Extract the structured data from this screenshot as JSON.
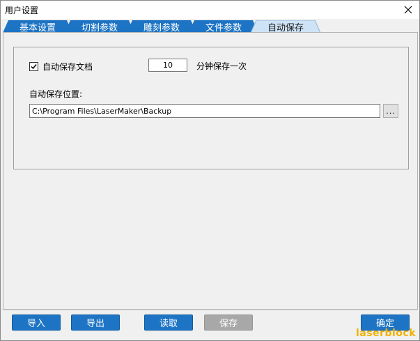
{
  "window": {
    "title": "用户设置"
  },
  "tabs": [
    {
      "label": "基本设置",
      "active": false
    },
    {
      "label": "切割参数",
      "active": false
    },
    {
      "label": "雕刻参数",
      "active": false
    },
    {
      "label": "文件参数",
      "active": false
    },
    {
      "label": "自动保存",
      "active": true
    }
  ],
  "autosave": {
    "enable_label": "自动保存文档",
    "enabled": true,
    "interval_value": "10",
    "interval_suffix": "分钟保存一次",
    "path_label": "自动保存位置:",
    "path_value": "C:\\Program Files\\LaserMaker\\Backup",
    "browse_label": "..."
  },
  "buttons": {
    "import": "导入",
    "export": "导出",
    "read": "读取",
    "save": "保存",
    "ok": "确定"
  },
  "watermark": "laserblock",
  "colors": {
    "tab_bg": "#1e74c4",
    "tab_active_bg": "#cfe3f6",
    "button_bg": "#1e74c4",
    "button_disabled_bg": "#a8a8a8",
    "watermark": "#f2b100"
  }
}
